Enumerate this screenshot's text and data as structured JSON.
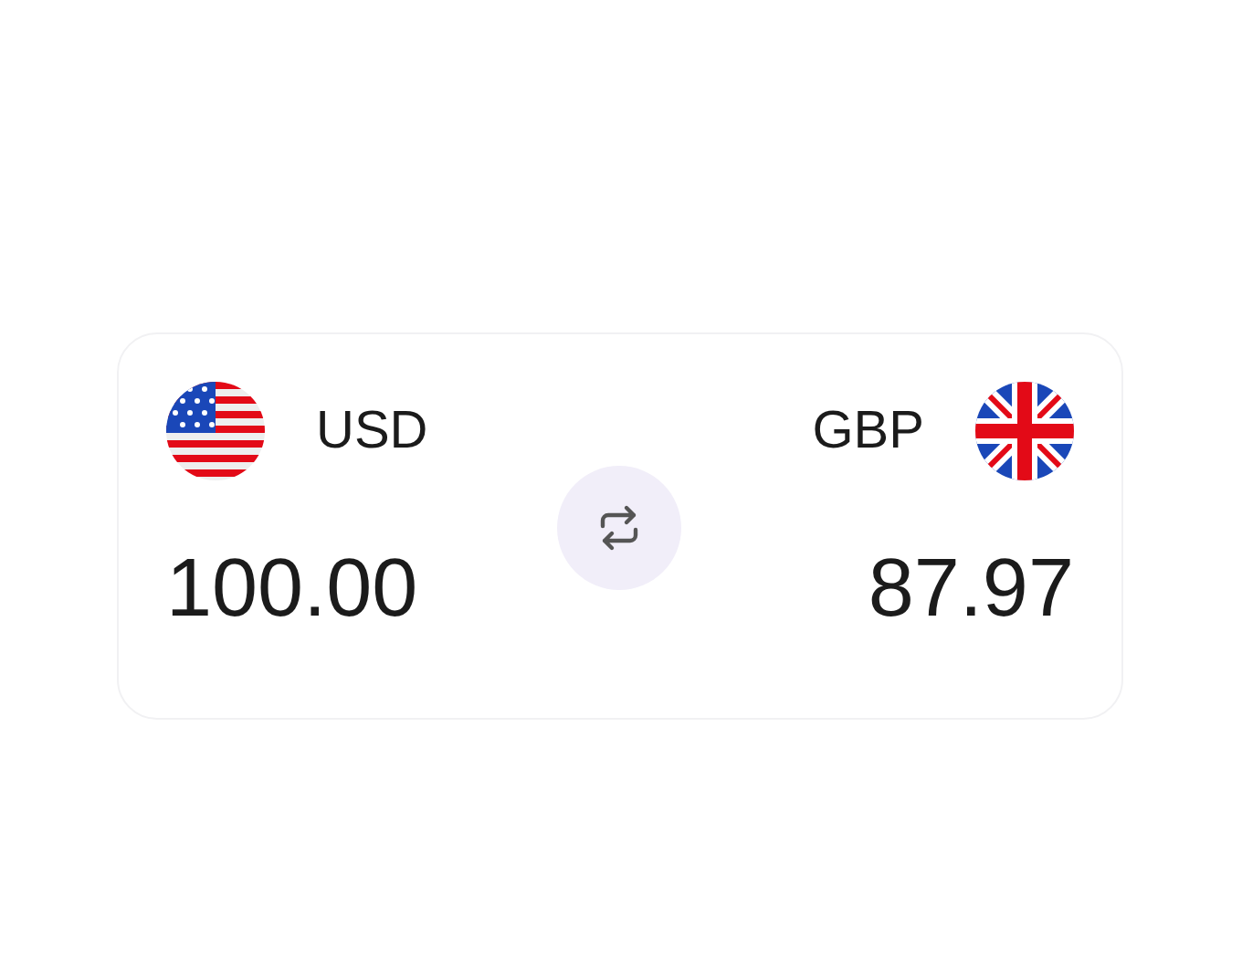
{
  "converter": {
    "from": {
      "code": "USD",
      "amount": "100.00"
    },
    "to": {
      "code": "GBP",
      "amount": "87.97"
    }
  }
}
